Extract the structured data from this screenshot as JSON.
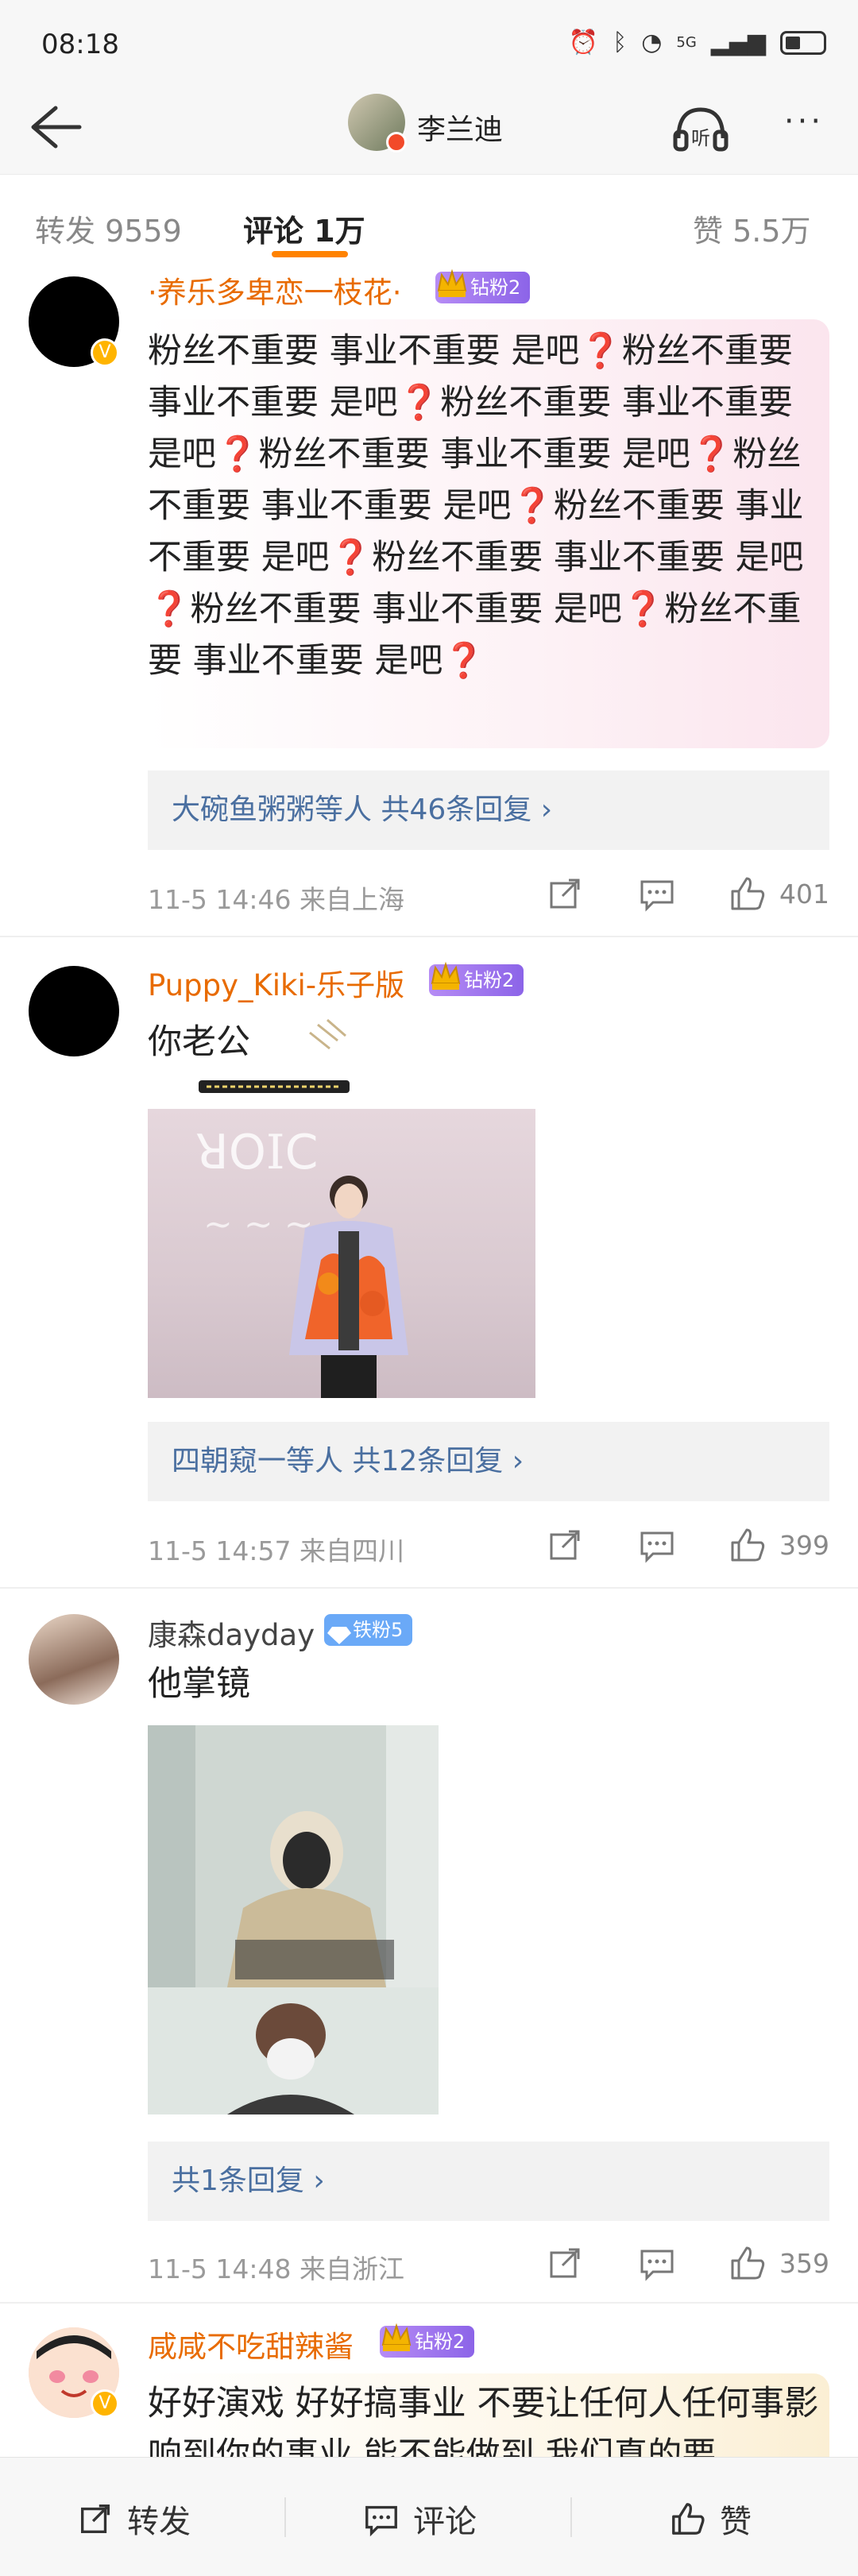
{
  "status_bar": {
    "time": "08:18",
    "network": "5G"
  },
  "header": {
    "title": "李兰迪",
    "back_icon": "back-arrow-icon",
    "listen_label": "听",
    "more_label": "···"
  },
  "tabs": [
    {
      "label": "转发 9559"
    },
    {
      "label": "评论 1万"
    },
    {
      "label": "赞 5.5万"
    }
  ],
  "comments": [
    {
      "username": "·养乐多卑恋一枝花·",
      "badge": "钻粉2",
      "text": "粉丝不重要 事业不重要 是吧❓粉丝不重要 事业不重要 是吧❓粉丝不重要 事业不重要 是吧❓粉丝不重要 事业不重要 是吧❓粉丝不重要 事业不重要 是吧❓粉丝不重要 事业不重要 是吧❓粉丝不重要 事业不重要 是吧❓粉丝不重要 事业不重要 是吧❓粉丝不重要 事业不重要 是吧❓",
      "reply_who": "大碗鱼粥粥等人",
      "reply_count": "共46条回复 ›",
      "meta": "11-5 14:46  来自上海",
      "likes": "401"
    },
    {
      "username": "Puppy_Kiki-乐子版",
      "badge": "钻粉2",
      "text": "你老公",
      "reply_who": "四朝窥一等人",
      "reply_count": "共12条回复 ›",
      "meta": "11-5 14:57  来自四川",
      "likes": "399"
    },
    {
      "username": "康森dayday",
      "badge": "铁粉5",
      "text": "他掌镜",
      "reply_who": "",
      "reply_count": "共1条回复 ›",
      "meta": "11-5 14:48  来自浙江",
      "likes": "359"
    },
    {
      "username": "咸咸不吃甜辣酱",
      "badge": "钻粉2",
      "text": "好好演戏 好好搞事业 不要让任何人任何事影响到你的事业 能不能做到 我们真的要"
    }
  ],
  "bottom_bar": {
    "repost_label": "转发",
    "comment_label": "评论",
    "like_label": "赞"
  },
  "colors": {
    "accent": "#ff8200",
    "link": "#4a6fa0",
    "username": "#e86b00"
  }
}
